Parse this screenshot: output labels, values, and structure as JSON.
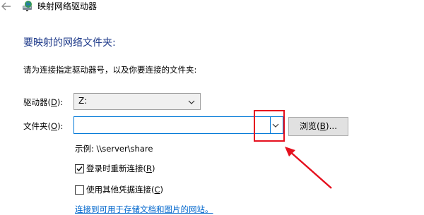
{
  "window": {
    "title": "映射网络驱动器",
    "back_icon": "arrow-left-icon",
    "app_icon": "network-drive-icon"
  },
  "heading": "要映射的网络文件夹:",
  "instructions": "请为连接指定驱动器号，以及你要连接的文件夹:",
  "drive": {
    "label_prefix": "驱动器(",
    "label_key": "D",
    "label_suffix": "):",
    "value": "Z:"
  },
  "folder": {
    "label_prefix": "文件夹(",
    "label_key": "O",
    "label_suffix": "):",
    "value": ""
  },
  "browse": {
    "prefix": "浏览(",
    "key": "B",
    "suffix": ")..."
  },
  "example": "示例: \\\\server\\share",
  "options": {
    "reconnect": {
      "prefix": "登录时重新连接(",
      "key": "R",
      "suffix": ")",
      "checked": true
    },
    "other_credentials": {
      "prefix": "使用其他凭据连接(",
      "key": "C",
      "suffix": ")",
      "checked": false
    }
  },
  "link": "连接到可用于存储文档和图片的网站。",
  "colors": {
    "heading": "#1e3a8a",
    "link": "#0066cc",
    "annotation_red": "#e5101e",
    "focus_blue": "#0078d7"
  }
}
